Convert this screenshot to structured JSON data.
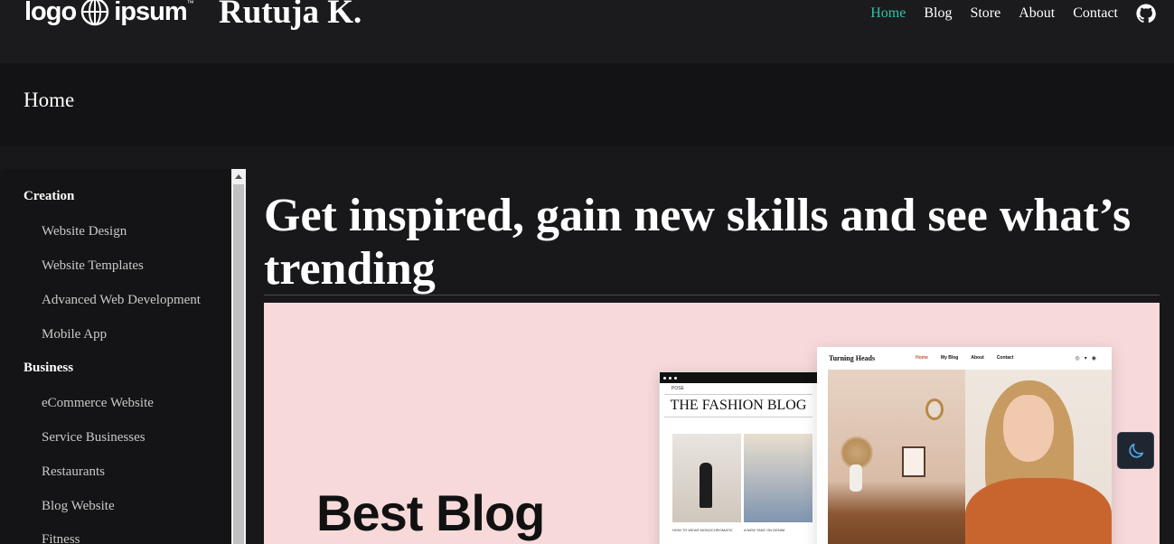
{
  "brand": {
    "logo_left": "logo",
    "logo_right": "ipsum",
    "site_name": "Rutuja K."
  },
  "nav": {
    "items": [
      {
        "label": "Home",
        "active": true
      },
      {
        "label": "Blog",
        "active": false
      },
      {
        "label": "Store",
        "active": false
      },
      {
        "label": "About",
        "active": false
      },
      {
        "label": "Contact",
        "active": false
      }
    ],
    "github_icon": "github-icon",
    "active_color": "#2ec4a6"
  },
  "page_header": {
    "title": "Home"
  },
  "sidebar": {
    "groups": [
      {
        "label": "Creation",
        "items": [
          "Website Design",
          "Website Templates",
          "Advanced Web Development",
          "Mobile App"
        ]
      },
      {
        "label": "Business",
        "items": [
          "eCommerce Website",
          "Service Businesses",
          "Restaurants",
          "Blog Website",
          "Fitness"
        ]
      }
    ]
  },
  "main": {
    "heading": "Get inspired, gain new skills and see what’s trending",
    "banner": {
      "title": "Best Blog",
      "phone_nav": "POSE",
      "phone_title": "THE FASHION BLOG",
      "phone_caption_1": "HOW TO WEAR MONOCHROMATIC",
      "phone_caption_2": "A NEW TAKE ON DENIM",
      "desktop_brand": "Turning Heads",
      "desktop_links": [
        "Home",
        "My Blog",
        "About",
        "Contact"
      ],
      "background_color": "#f7d9da"
    }
  },
  "theme_toggle": {
    "icon": "moon-icon"
  }
}
